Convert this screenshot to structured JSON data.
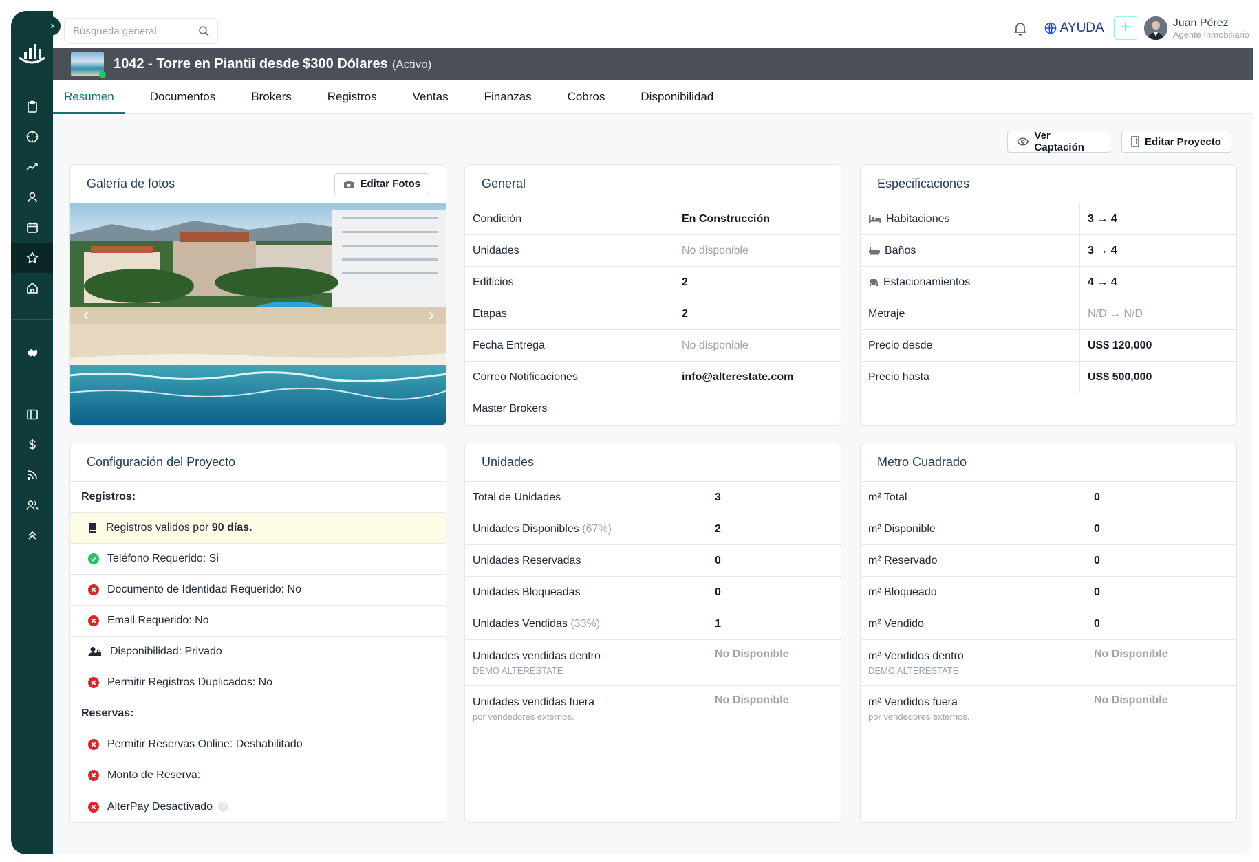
{
  "search": {
    "placeholder": "Búsqueda general"
  },
  "header": {
    "help_label": "AYUDA",
    "add_label": "+",
    "user_name": "Juan Pérez",
    "user_role": "Agente Inmobiliario"
  },
  "project": {
    "title": "1042 - Torre en Piantii desde $300 Dólares",
    "status": "(Activo)"
  },
  "tabs": [
    {
      "label": "Resumen"
    },
    {
      "label": "Documentos"
    },
    {
      "label": "Brokers"
    },
    {
      "label": "Registros"
    },
    {
      "label": "Ventas"
    },
    {
      "label": "Finanzas"
    },
    {
      "label": "Cobros"
    },
    {
      "label": "Disponibilidad"
    }
  ],
  "actions": {
    "view_label": "Ver Captación",
    "edit_label": "Editar Proyecto"
  },
  "gallery": {
    "title": "Galería de fotos",
    "edit_label": "Editar Fotos",
    "prev": "‹",
    "next": "›"
  },
  "general": {
    "title": "General",
    "rows": [
      {
        "label": "Condición",
        "value": "En Construcción"
      },
      {
        "label": "Unidades",
        "value": "No disponible"
      },
      {
        "label": "Edificios",
        "value": "2"
      },
      {
        "label": "Etapas",
        "value": "2"
      },
      {
        "label": "Fecha Entrega",
        "value": "No disponible"
      },
      {
        "label": "Correo Notificaciones",
        "value": "info@alterestate.com"
      },
      {
        "label": "Master Brokers",
        "value": ""
      }
    ]
  },
  "specs": {
    "title": "Especificaciones",
    "rows": [
      {
        "label": "Habitaciones",
        "value": "3 → 4"
      },
      {
        "label": "Baños",
        "value": "3 → 4"
      },
      {
        "label": "Estacionamientos",
        "value": "4 → 4"
      },
      {
        "label": "Metraje",
        "value": "N/D → N/D"
      },
      {
        "label": "Precio desde",
        "value": "US$ 120,000"
      },
      {
        "label": "Precio hasta",
        "value": "US$ 500,000"
      }
    ]
  },
  "config": {
    "title": "Configuración del Proyecto",
    "registros_label": "Registros:",
    "registros_valid_prefix": "Registros validos por",
    "registros_valid_days": "90 días.",
    "telefono": "Teléfono Requerido: Si",
    "documento": "Documento de Identidad Requerido: No",
    "email": "Email Requerido: No",
    "disponibilidad": "Disponibilidad: Privado",
    "duplicados": "Permitir Registros Duplicados: No",
    "reservas_label": "Reservas:",
    "reservas_online": "Permitir Reservas Online: Deshabilitado",
    "monto": "Monto de Reserva:",
    "alterpay": "AlterPay Desactivado",
    "help_mark": "?"
  },
  "units": {
    "title": "Unidades",
    "total_label": "Total de Unidades",
    "total": "3",
    "disponibles_label": "Unidades Disponibles",
    "disponibles_pct": "(67%)",
    "disponibles": "2",
    "reservadas_label": "Unidades Reservadas",
    "reservadas": "0",
    "bloqueadas_label": "Unidades Bloqueadas",
    "bloqueadas": "0",
    "vendidas_label": "Unidades Vendidas",
    "vendidas_pct": "(33%)",
    "vendidas": "1",
    "dentro_label": "Unidades vendidas dentro",
    "dentro_sub": "DEMO ALTERESTATE",
    "dentro": "No Disponible",
    "fuera_label": "Unidades vendidas fuera",
    "fuera_sub": "por vendedores externos.",
    "fuera": "No Disponible"
  },
  "sqm": {
    "title": "Metro Cuadrado",
    "total_label": "m² Total",
    "total": "0",
    "disponible_label": "m² Disponible",
    "disponible": "0",
    "reservado_label": "m² Reservado",
    "reservado": "0",
    "bloqueado_label": "m² Bloqueado",
    "bloqueado": "0",
    "vendido_label": "m² Vendido",
    "vendido": "0",
    "dentro_label": "m² Vendidos dentro",
    "dentro_sub": "DEMO ALTERESTATE",
    "dentro": "No Disponible",
    "fuera_label": "m² Vendidos fuera",
    "fuera_sub": "por vendedores externos.",
    "fuera": "No Disponible"
  },
  "colors": {
    "sidebar": "#0f3b3a",
    "accent": "#0f766e",
    "danger": "#dc2626",
    "success": "#22c55e",
    "project_bar": "#4b5056"
  }
}
